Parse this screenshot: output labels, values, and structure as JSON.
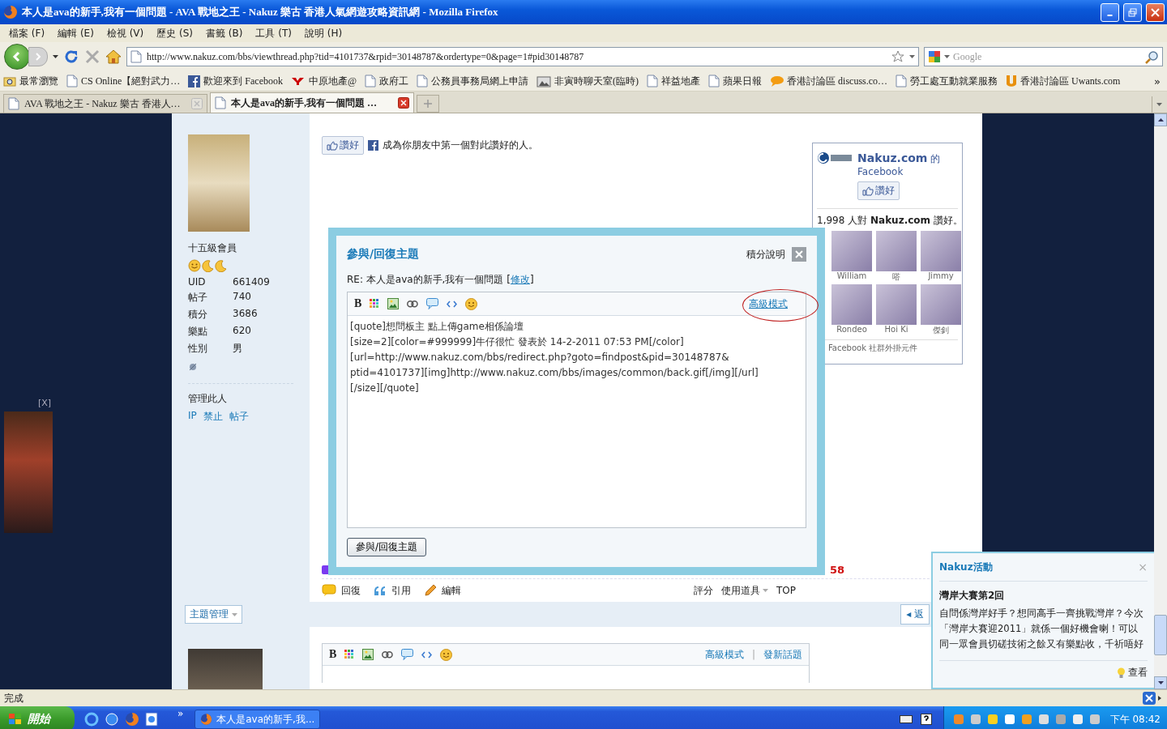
{
  "window": {
    "title": "本人是ava的新手,我有一個問題 - AVA 戰地之王 - Nakuz 樂古 香港人氣網遊攻略資訊網 - Mozilla Firefox"
  },
  "menu": [
    "檔案 (F)",
    "編輯 (E)",
    "檢視 (V)",
    "歷史 (S)",
    "書籤 (B)",
    "工具 (T)",
    "說明 (H)"
  ],
  "navigation": {
    "url": "http://www.nakuz.com/bbs/viewthread.php?tid=4101737&rpid=30148787&ordertype=0&page=1#pid30148787",
    "search": {
      "placeholder": "Google"
    }
  },
  "bookmarks": [
    {
      "label": "最常瀏覽",
      "kind": "smart"
    },
    {
      "label": "CS Online【絕對武力…",
      "kind": "page"
    },
    {
      "label": "歡迎來到 Facebook",
      "kind": "facebook"
    },
    {
      "label": "中原地產@",
      "kind": "yahoo"
    },
    {
      "label": "政府工",
      "kind": "page"
    },
    {
      "label": "公務員事務局網上申請",
      "kind": "page"
    },
    {
      "label": "非寅時聊天室(臨時)",
      "kind": "image"
    },
    {
      "label": "祥益地產",
      "kind": "page"
    },
    {
      "label": "蘋果日報",
      "kind": "page"
    },
    {
      "label": "香港討論區 discuss.co…",
      "kind": "bubble"
    },
    {
      "label": "勞工處互動就業服務",
      "kind": "page"
    },
    {
      "label": "香港討論區 Uwants.com",
      "kind": "u"
    }
  ],
  "bookmarks_more": "»",
  "tabs": [
    {
      "label": "AVA 戰地之王 - Nakuz 樂古 香港人…",
      "selected": false
    },
    {
      "label": "本人是ava的新手,我有一個問題 …",
      "selected": true
    }
  ],
  "profile": {
    "rank": "十五級會員",
    "stats": [
      {
        "label": "UID",
        "value": "661409"
      },
      {
        "label": "帖子",
        "value": "740"
      },
      {
        "label": "積分",
        "value": "3686"
      },
      {
        "label": "樂點",
        "value": "620"
      },
      {
        "label": "性別",
        "value": "男"
      }
    ],
    "manage_title": "管理此人",
    "manage_links": [
      "IP",
      "禁止",
      "帖子"
    ]
  },
  "like_bar": {
    "button": "讚好",
    "text": "成為你朋友中第一個對此讚好的人。"
  },
  "facebook_box": {
    "name": "Nakuz.com",
    "suffix": "的",
    "subtitle": "Facebook",
    "like_button": "讚好",
    "count_text": "1,998 人對 **Nakuz.com** 讚好。",
    "fans": [
      {
        "name": "William"
      },
      {
        "name": "嗒"
      },
      {
        "name": "Jimmy"
      },
      {
        "name": "Rondeo"
      },
      {
        "name": "Hoi Ki"
      },
      {
        "name": "傑釗"
      }
    ],
    "footer": "Facebook 社群外掛元件"
  },
  "post": {
    "score_fragment": "58",
    "actions": [
      {
        "kind": "reply",
        "label": "回復"
      },
      {
        "kind": "quote",
        "label": "引用"
      },
      {
        "kind": "edit",
        "label": "編輯"
      }
    ],
    "rate": "評分",
    "tools": "使用道具",
    "top": "TOP"
  },
  "thread_bar": {
    "manage_button": "主題管理",
    "back_arrow": "◂",
    "back_button": "返"
  },
  "quick_reply": {
    "toolbar": [
      {
        "kind": "bold",
        "label": "B"
      },
      {
        "kind": "color"
      },
      {
        "kind": "image"
      },
      {
        "kind": "link"
      },
      {
        "kind": "quote"
      },
      {
        "kind": "code"
      },
      {
        "kind": "smiley"
      }
    ],
    "links": [
      "高級模式",
      "發新話題"
    ],
    "separator": "|"
  },
  "reply_dialog": {
    "title": "參與/回復主題",
    "help_link": "積分說明",
    "subject": "RE: 本人是ava的新手,我有一個問題",
    "edit_link": "修改",
    "brackets": [
      "[",
      "]"
    ],
    "toolbar": [
      {
        "kind": "bold",
        "label": "B"
      },
      {
        "kind": "color"
      },
      {
        "kind": "image"
      },
      {
        "kind": "link"
      },
      {
        "kind": "quote"
      },
      {
        "kind": "code"
      },
      {
        "kind": "smiley"
      }
    ],
    "advanced_link": "高級模式",
    "body": "[quote]想問板主 點上傳game相係論壇\n[size=2][color=#999999]牛仔很忙 發表於 14-2-2011 07:53 PM[/color]\n[url=http://www.nakuz.com/bbs/redirect.php?goto=findpost&pid=30148787&\nptid=4101737][img]http://www.nakuz.com/bbs/images/common/back.gif[/img][/url]\n[/size][/quote]",
    "submit": "參與/回復主題"
  },
  "ad": {
    "close": "[X]"
  },
  "popup": {
    "title": "Nakuz活動",
    "close": "×",
    "headline": "灣岸大賽第2回",
    "body": "自問係灣岸好手？想同高手一齊挑戰灣岸？今次「灣岸大賽迎2011」就係一個好機會喇！可以同一眾會員切磋技術之餘又有樂點收，千祈唔好",
    "link": "查看"
  },
  "status_bar": {
    "text": "完成"
  },
  "taskbar": {
    "start": "開始",
    "more": "»",
    "tasks": [
      {
        "label": "本人是ava的新手,我..."
      }
    ],
    "clock": "下午 08:42"
  }
}
